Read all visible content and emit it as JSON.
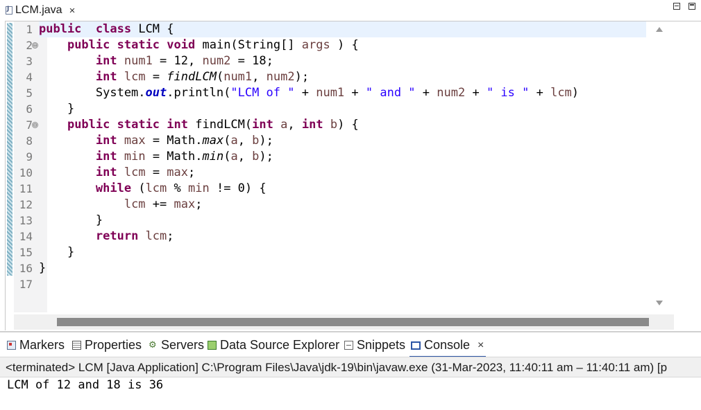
{
  "editor": {
    "tab": {
      "filename": "LCM.java",
      "close_label": "×"
    },
    "code_lines": [
      {
        "num": "1",
        "fold": "",
        "tokens": [
          [
            "kw",
            "public"
          ],
          [
            "",
            "  "
          ],
          [
            "kw",
            "class"
          ],
          [
            "",
            " LCM {"
          ]
        ]
      },
      {
        "num": "2",
        "fold": "⊖",
        "tokens": [
          [
            "",
            "    "
          ],
          [
            "kw",
            "public"
          ],
          [
            "",
            " "
          ],
          [
            "kw",
            "static"
          ],
          [
            "",
            " "
          ],
          [
            "kw",
            "void"
          ],
          [
            "",
            " main(String[] "
          ],
          [
            "var",
            "args"
          ],
          [
            "",
            " ) {"
          ]
        ]
      },
      {
        "num": "3",
        "fold": "",
        "tokens": [
          [
            "",
            "        "
          ],
          [
            "kw",
            "int"
          ],
          [
            "",
            " "
          ],
          [
            "var",
            "num1"
          ],
          [
            "",
            " = 12, "
          ],
          [
            "var",
            "num2"
          ],
          [
            "",
            " = 18;"
          ]
        ]
      },
      {
        "num": "4",
        "fold": "",
        "tokens": [
          [
            "",
            "        "
          ],
          [
            "kw",
            "int"
          ],
          [
            "",
            " "
          ],
          [
            "var",
            "lcm"
          ],
          [
            "",
            " = "
          ],
          [
            "static-method",
            "findLCM"
          ],
          [
            "",
            "("
          ],
          [
            "var",
            "num1"
          ],
          [
            "",
            ", "
          ],
          [
            "var",
            "num2"
          ],
          [
            "",
            ");"
          ]
        ]
      },
      {
        "num": "5",
        "fold": "",
        "tokens": [
          [
            "",
            "        System."
          ],
          [
            "static-field",
            "out"
          ],
          [
            "",
            ".println("
          ],
          [
            "str",
            "\"LCM of \""
          ],
          [
            "",
            " + "
          ],
          [
            "var",
            "num1"
          ],
          [
            "",
            " + "
          ],
          [
            "str",
            "\" and \""
          ],
          [
            "",
            " + "
          ],
          [
            "var",
            "num2"
          ],
          [
            "",
            " + "
          ],
          [
            "str",
            "\" is \""
          ],
          [
            "",
            " + "
          ],
          [
            "var",
            "lcm"
          ],
          [
            "",
            ")"
          ]
        ]
      },
      {
        "num": "6",
        "fold": "",
        "tokens": [
          [
            "",
            "    }"
          ]
        ]
      },
      {
        "num": "7",
        "fold": "⊖",
        "tokens": [
          [
            "",
            "    "
          ],
          [
            "kw",
            "public"
          ],
          [
            "",
            " "
          ],
          [
            "kw",
            "static"
          ],
          [
            "",
            " "
          ],
          [
            "kw",
            "int"
          ],
          [
            "",
            " findLCM("
          ],
          [
            "kw",
            "int"
          ],
          [
            "",
            " "
          ],
          [
            "var",
            "a"
          ],
          [
            "",
            ", "
          ],
          [
            "kw",
            "int"
          ],
          [
            "",
            " "
          ],
          [
            "var",
            "b"
          ],
          [
            "",
            ") {"
          ]
        ]
      },
      {
        "num": "8",
        "fold": "",
        "tokens": [
          [
            "",
            "        "
          ],
          [
            "kw",
            "int"
          ],
          [
            "",
            " "
          ],
          [
            "var",
            "max"
          ],
          [
            "",
            " = Math."
          ],
          [
            "static-method",
            "max"
          ],
          [
            "",
            "("
          ],
          [
            "var",
            "a"
          ],
          [
            "",
            ", "
          ],
          [
            "var",
            "b"
          ],
          [
            "",
            ");"
          ]
        ]
      },
      {
        "num": "9",
        "fold": "",
        "tokens": [
          [
            "",
            "        "
          ],
          [
            "kw",
            "int"
          ],
          [
            "",
            " "
          ],
          [
            "var",
            "min"
          ],
          [
            "",
            " = Math."
          ],
          [
            "static-method",
            "min"
          ],
          [
            "",
            "("
          ],
          [
            "var",
            "a"
          ],
          [
            "",
            ", "
          ],
          [
            "var",
            "b"
          ],
          [
            "",
            ");"
          ]
        ]
      },
      {
        "num": "10",
        "fold": "",
        "tokens": [
          [
            "",
            "        "
          ],
          [
            "kw",
            "int"
          ],
          [
            "",
            " "
          ],
          [
            "var",
            "lcm"
          ],
          [
            "",
            " = "
          ],
          [
            "var",
            "max"
          ],
          [
            "",
            ";"
          ]
        ]
      },
      {
        "num": "11",
        "fold": "",
        "tokens": [
          [
            "",
            "        "
          ],
          [
            "kw",
            "while"
          ],
          [
            "",
            " ("
          ],
          [
            "var",
            "lcm"
          ],
          [
            "",
            " % "
          ],
          [
            "var",
            "min"
          ],
          [
            "",
            " != 0) {"
          ]
        ]
      },
      {
        "num": "12",
        "fold": "",
        "tokens": [
          [
            "",
            "            "
          ],
          [
            "var",
            "lcm"
          ],
          [
            "",
            " += "
          ],
          [
            "var",
            "max"
          ],
          [
            "",
            ";"
          ]
        ]
      },
      {
        "num": "13",
        "fold": "",
        "tokens": [
          [
            "",
            "        }"
          ]
        ]
      },
      {
        "num": "14",
        "fold": "",
        "tokens": [
          [
            "",
            "        "
          ],
          [
            "kw",
            "return"
          ],
          [
            "",
            " "
          ],
          [
            "var",
            "lcm"
          ],
          [
            "",
            ";"
          ]
        ]
      },
      {
        "num": "15",
        "fold": "",
        "tokens": [
          [
            "",
            "    }"
          ]
        ]
      },
      {
        "num": "16",
        "fold": "",
        "tokens": [
          [
            "",
            "}"
          ]
        ]
      },
      {
        "num": "17",
        "fold": "",
        "tokens": []
      }
    ]
  },
  "panel": {
    "tabs": [
      {
        "name": "markers",
        "label": "Markers",
        "icon": "markers-icon"
      },
      {
        "name": "properties",
        "label": "Properties",
        "icon": "properties-icon"
      },
      {
        "name": "servers",
        "label": "Servers",
        "icon": "servers-icon"
      },
      {
        "name": "data-source-explorer",
        "label": "Data Source Explorer",
        "icon": "database-icon"
      },
      {
        "name": "snippets",
        "label": "Snippets",
        "icon": "snippets-icon"
      },
      {
        "name": "console",
        "label": "Console",
        "icon": "console-icon",
        "active": true
      }
    ],
    "console_close": "×",
    "status": "<terminated> LCM [Java Application] C:\\Program Files\\Java\\jdk-19\\bin\\javaw.exe  (31-Mar-2023, 11:40:11 am – 11:40:11 am) [p",
    "output": "LCM of 12 and 18 is 36"
  },
  "colors": {
    "keyword": "#7f0055",
    "variable": "#6a3e3e",
    "string": "#2a00ff",
    "static_field": "#0000c0",
    "active_tab_accent": "#2d56a5"
  }
}
